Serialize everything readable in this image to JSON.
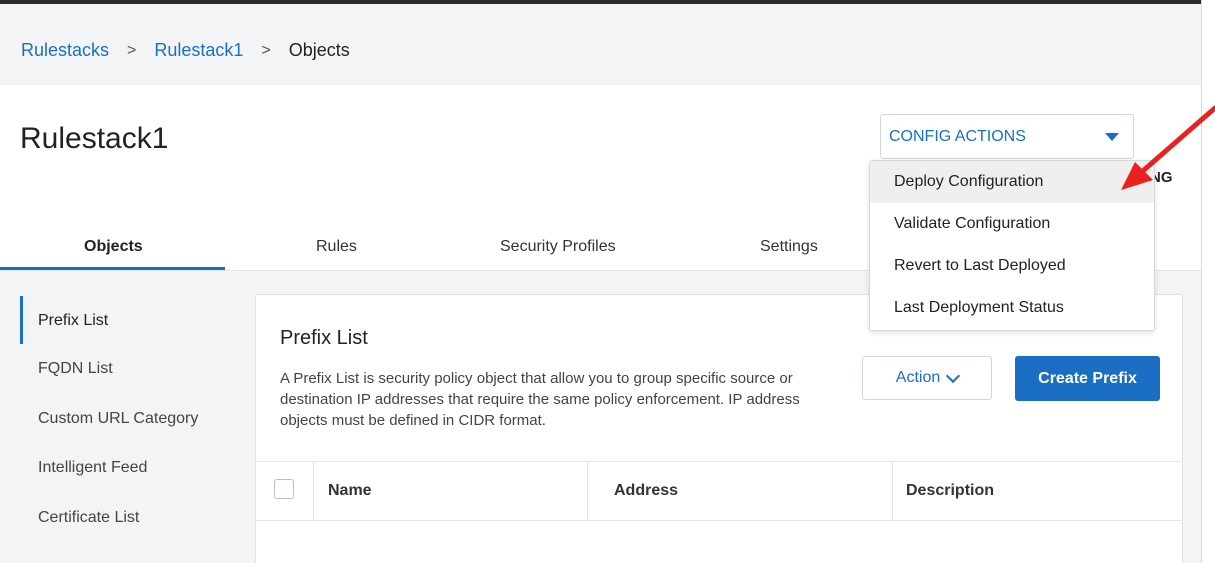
{
  "breadcrumb": {
    "items": [
      "Rulestacks",
      "Rulestack1"
    ],
    "current": "Objects",
    "separator": ">"
  },
  "page": {
    "title": "Rulestack1",
    "partial_status_text": "NG"
  },
  "config_actions": {
    "label": "CONFIG ACTIONS",
    "menu": [
      {
        "label": "Deploy Configuration"
      },
      {
        "label": "Validate Configuration"
      },
      {
        "label": "Revert to Last Deployed"
      },
      {
        "label": "Last Deployment Status"
      }
    ]
  },
  "tabs": [
    {
      "label": "Objects"
    },
    {
      "label": "Rules"
    },
    {
      "label": "Security Profiles"
    },
    {
      "label": "Settings"
    }
  ],
  "sidenav": [
    {
      "label": "Prefix List"
    },
    {
      "label": "FQDN List"
    },
    {
      "label": "Custom URL Category"
    },
    {
      "label": "Intelligent Feed"
    },
    {
      "label": "Certificate List"
    }
  ],
  "card": {
    "title": "Prefix List",
    "description": "A Prefix List is security policy object that allow you to group specific source or destination IP addresses that require the same policy enforcement. IP address objects must be defined in CIDR format.",
    "action_label": "Action",
    "create_label": "Create Prefix"
  },
  "table": {
    "columns": [
      "Name",
      "Address",
      "Description"
    ]
  },
  "colors": {
    "accent": "#1a6fc4",
    "annotation_arrow": "#e8231f"
  }
}
